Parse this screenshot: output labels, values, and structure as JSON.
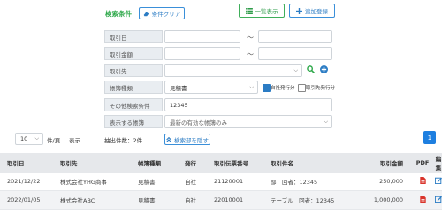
{
  "search": {
    "title": "検索条件",
    "clear_label": "条件クリア",
    "list_label": "一覧表示",
    "add_label": "追加登録"
  },
  "form": {
    "date_label": "取引日",
    "amount_label": "取引金額",
    "partner_label": "取引先",
    "type_label": "帳簿種類",
    "type_value": "見積書",
    "issuer_self_label": "自社発行分",
    "issuer_partner_label": "取引先発行分",
    "other_label": "その他検索条件",
    "other_value": "12345",
    "display_label": "表示する帳簿",
    "display_value": "最新の有効な帳簿のみ",
    "range_sep": "～"
  },
  "list_controls": {
    "per_page_value": "10",
    "per_page_unit": "件/頁",
    "display_word": "表示",
    "count_text": "抽出件数：2件",
    "hide_search_label": "検索部を隠す",
    "page_number": "1"
  },
  "table": {
    "headers": [
      "取引日",
      "取引先",
      "帳簿種類",
      "発行",
      "取引伝票番号",
      "取引件名",
      "取引金額",
      "PDF",
      "編集"
    ],
    "rows": [
      {
        "date": "2021/12/22",
        "partner": "株式会社YHG商事",
        "type": "見積書",
        "issuer": "自社",
        "number": "21120001",
        "subject": "鄙　回者：12345",
        "amount": "250,000"
      },
      {
        "date": "2022/01/05",
        "partner": "株式会社ABC",
        "type": "見積書",
        "issuer": "自社",
        "number": "22010001",
        "subject": "テーブル　回者：12345",
        "amount": "1,000,000"
      }
    ]
  },
  "colors": {
    "accent_blue": "#2b7cc4",
    "accent_green": "#2ea84a",
    "pdf_red": "#d9342b"
  }
}
